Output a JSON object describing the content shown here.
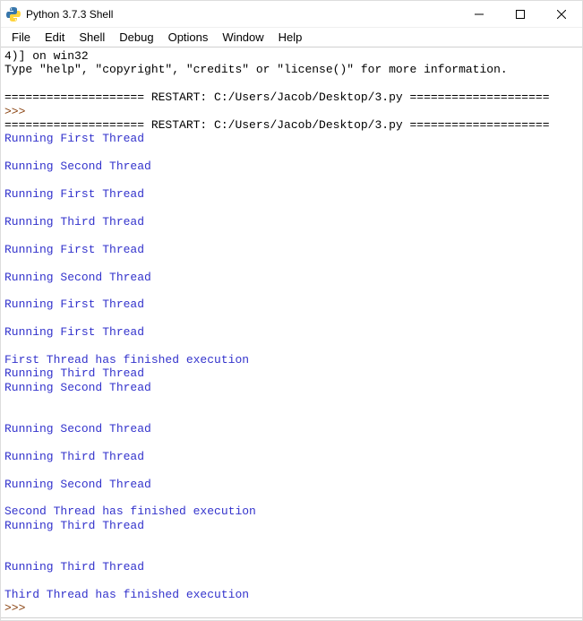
{
  "window": {
    "title": "Python 3.7.3 Shell"
  },
  "menu": {
    "items": [
      "File",
      "Edit",
      "Shell",
      "Debug",
      "Options",
      "Window",
      "Help"
    ]
  },
  "console": {
    "lines": [
      {
        "text": "4)] on win32",
        "cls": "out-black"
      },
      {
        "text": "Type \"help\", \"copyright\", \"credits\" or \"license()\" for more information.",
        "cls": "out-black"
      },
      {
        "text": "",
        "cls": "out-black"
      },
      {
        "text": "==================== RESTART: C:/Users/Jacob/Desktop/3.py ====================",
        "cls": "out-black"
      },
      {
        "text": ">>> ",
        "cls": "prompt"
      },
      {
        "text": "==================== RESTART: C:/Users/Jacob/Desktop/3.py ====================",
        "cls": "out-black"
      },
      {
        "text": "Running First Thread",
        "cls": "out-blue"
      },
      {
        "text": "",
        "cls": "out-blue"
      },
      {
        "text": "Running Second Thread",
        "cls": "out-blue"
      },
      {
        "text": "",
        "cls": "out-blue"
      },
      {
        "text": "Running First Thread",
        "cls": "out-blue"
      },
      {
        "text": "",
        "cls": "out-blue"
      },
      {
        "text": "Running Third Thread",
        "cls": "out-blue"
      },
      {
        "text": "",
        "cls": "out-blue"
      },
      {
        "text": "Running First Thread",
        "cls": "out-blue"
      },
      {
        "text": "",
        "cls": "out-blue"
      },
      {
        "text": "Running Second Thread",
        "cls": "out-blue"
      },
      {
        "text": "",
        "cls": "out-blue"
      },
      {
        "text": "Running First Thread",
        "cls": "out-blue"
      },
      {
        "text": "",
        "cls": "out-blue"
      },
      {
        "text": "Running First Thread",
        "cls": "out-blue"
      },
      {
        "text": "",
        "cls": "out-blue"
      },
      {
        "text": "First Thread has finished execution",
        "cls": "out-blue"
      },
      {
        "text": "Running Third Thread",
        "cls": "out-blue"
      },
      {
        "text": "Running Second Thread",
        "cls": "out-blue"
      },
      {
        "text": "",
        "cls": "out-blue"
      },
      {
        "text": "",
        "cls": "out-blue"
      },
      {
        "text": "Running Second Thread",
        "cls": "out-blue"
      },
      {
        "text": "",
        "cls": "out-blue"
      },
      {
        "text": "Running Third Thread",
        "cls": "out-blue"
      },
      {
        "text": "",
        "cls": "out-blue"
      },
      {
        "text": "Running Second Thread",
        "cls": "out-blue"
      },
      {
        "text": "",
        "cls": "out-blue"
      },
      {
        "text": "Second Thread has finished execution",
        "cls": "out-blue"
      },
      {
        "text": "Running Third Thread",
        "cls": "out-blue"
      },
      {
        "text": "",
        "cls": "out-blue"
      },
      {
        "text": "",
        "cls": "out-blue"
      },
      {
        "text": "Running Third Thread",
        "cls": "out-blue"
      },
      {
        "text": "",
        "cls": "out-blue"
      },
      {
        "text": "Third Thread has finished execution",
        "cls": "out-blue"
      },
      {
        "text": ">>> ",
        "cls": "prompt"
      }
    ]
  }
}
